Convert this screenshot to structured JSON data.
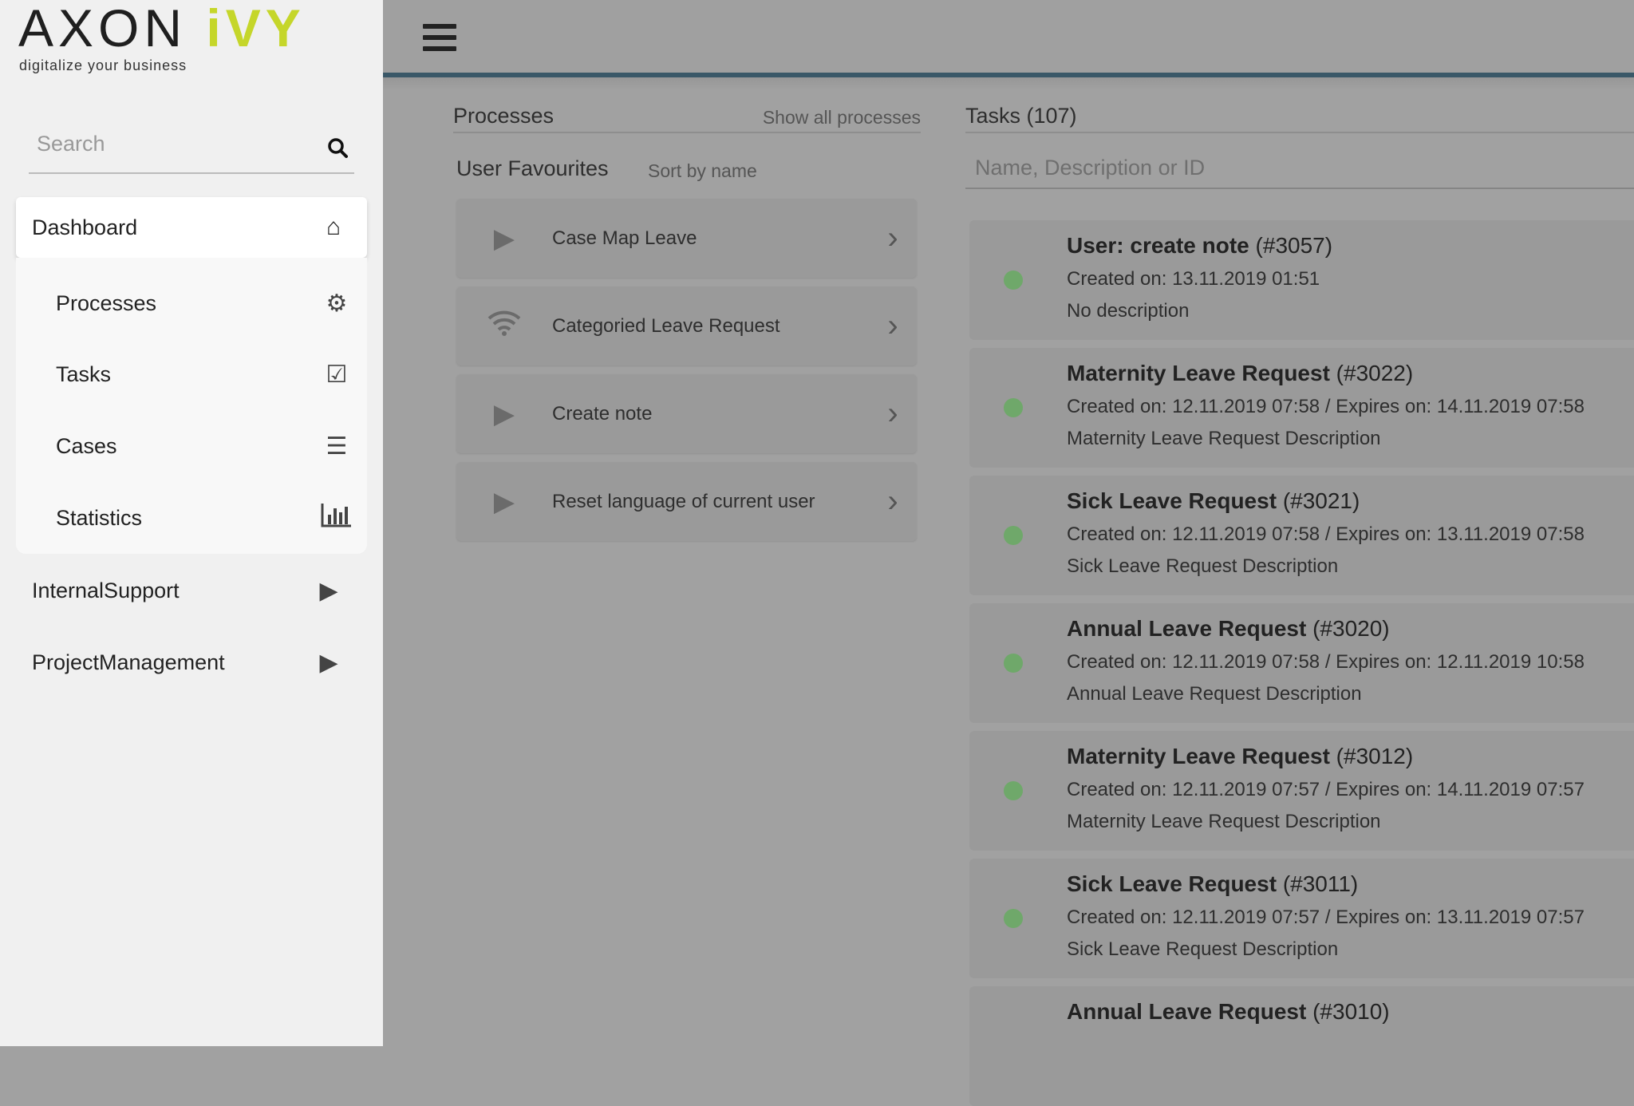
{
  "logo": {
    "brand_a": "AXON ",
    "brand_b": "iVY",
    "tagline": "digitalize your business"
  },
  "sidebar": {
    "search_placeholder": "Search",
    "dashboard": "Dashboard",
    "sub_items": [
      {
        "label": "Processes",
        "icon": "gears-icon"
      },
      {
        "label": "Tasks",
        "icon": "check-square-icon"
      },
      {
        "label": "Cases",
        "icon": "list-icon"
      },
      {
        "label": "Statistics",
        "icon": "bar-chart-icon"
      }
    ],
    "top_items": [
      {
        "label": "InternalSupport"
      },
      {
        "label": "ProjectManagement"
      }
    ]
  },
  "processes": {
    "title": "Processes",
    "show_all": "Show all processes",
    "favourites": "User Favourites",
    "sort": "Sort by name",
    "items": [
      {
        "label": "Case Map Leave",
        "icon": "play-icon"
      },
      {
        "label": "Categoried Leave Request",
        "icon": "wifi-icon"
      },
      {
        "label": "Create note",
        "icon": "play-icon"
      },
      {
        "label": "Reset language of current user",
        "icon": "play-icon"
      }
    ]
  },
  "tasks": {
    "title": "Tasks (107)",
    "search_placeholder": "Name, Description or ID",
    "items": [
      {
        "name": "User: create note",
        "id": "(#3057)",
        "dates": "Created on: 13.11.2019 01:51",
        "desc": "No description"
      },
      {
        "name": "Maternity Leave Request",
        "id": "(#3022)",
        "dates": "Created on: 12.11.2019 07:58 / Expires on: 14.11.2019 07:58",
        "desc": "Maternity Leave Request Description"
      },
      {
        "name": "Sick Leave Request",
        "id": "(#3021)",
        "dates": "Created on: 12.11.2019 07:58 / Expires on: 13.11.2019 07:58",
        "desc": "Sick Leave Request Description"
      },
      {
        "name": "Annual Leave Request",
        "id": "(#3020)",
        "dates": "Created on: 12.11.2019 07:58 / Expires on: 12.11.2019 10:58",
        "desc": "Annual Leave Request Description"
      },
      {
        "name": "Maternity Leave Request",
        "id": "(#3012)",
        "dates": "Created on: 12.11.2019 07:57 / Expires on: 14.11.2019 07:57",
        "desc": "Maternity Leave Request Description"
      },
      {
        "name": "Sick Leave Request",
        "id": "(#3011)",
        "dates": "Created on: 12.11.2019 07:57 / Expires on: 13.11.2019 07:57",
        "desc": "Sick Leave Request Description"
      },
      {
        "name": "Annual Leave Request",
        "id": "(#3010)",
        "dates": "",
        "desc": ""
      }
    ]
  },
  "colors": {
    "accent": "#c5d62a",
    "header_line": "#3a5868",
    "status": "#6fa86a"
  }
}
